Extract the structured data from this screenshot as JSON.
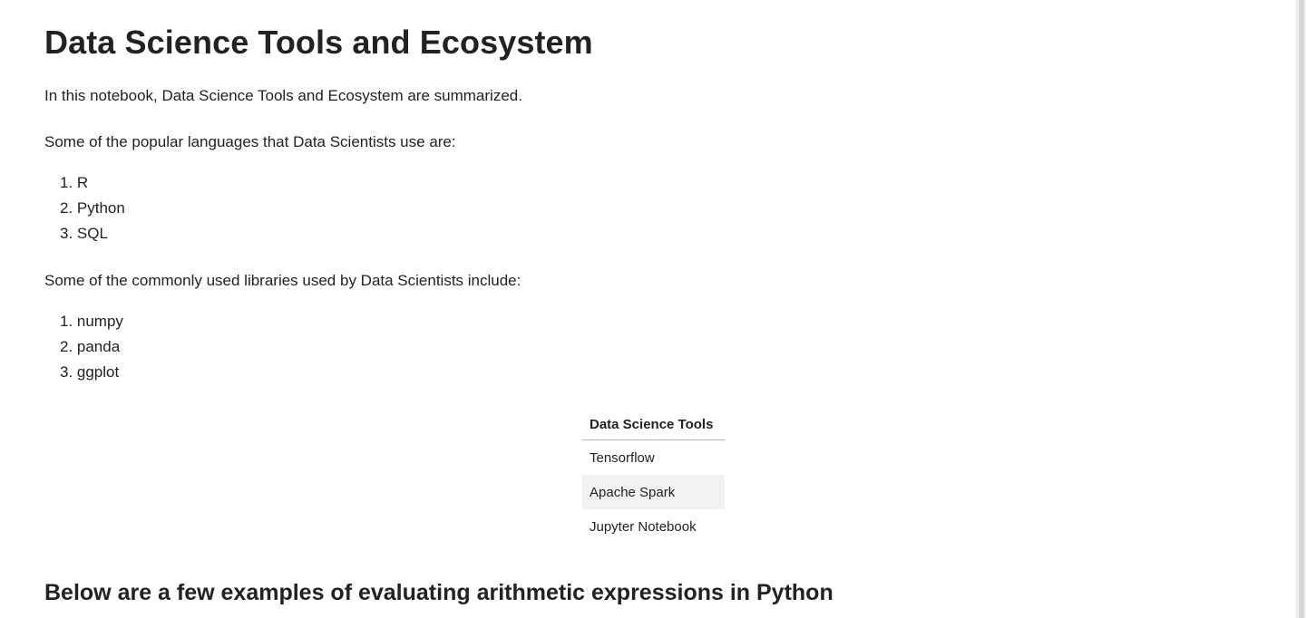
{
  "title": "Data Science Tools and Ecosystem",
  "intro": "In this notebook, Data Science Tools and Ecosystem are summarized.",
  "languages_heading": "Some of the popular languages that Data Scientists use are:",
  "languages": [
    "1. R",
    "2. Python",
    "3. SQL"
  ],
  "libraries_heading": "Some of the commonly used libraries used by Data Scientists include:",
  "libraries": [
    "1. numpy",
    "2. panda",
    "3. ggplot"
  ],
  "tools_table": {
    "header": "Data Science Tools",
    "rows": [
      "Tensorflow",
      "Apache Spark",
      "Jupyter Notebook"
    ]
  },
  "arithmetic_heading": "Below are a few examples of evaluating arithmetic expressions in Python"
}
